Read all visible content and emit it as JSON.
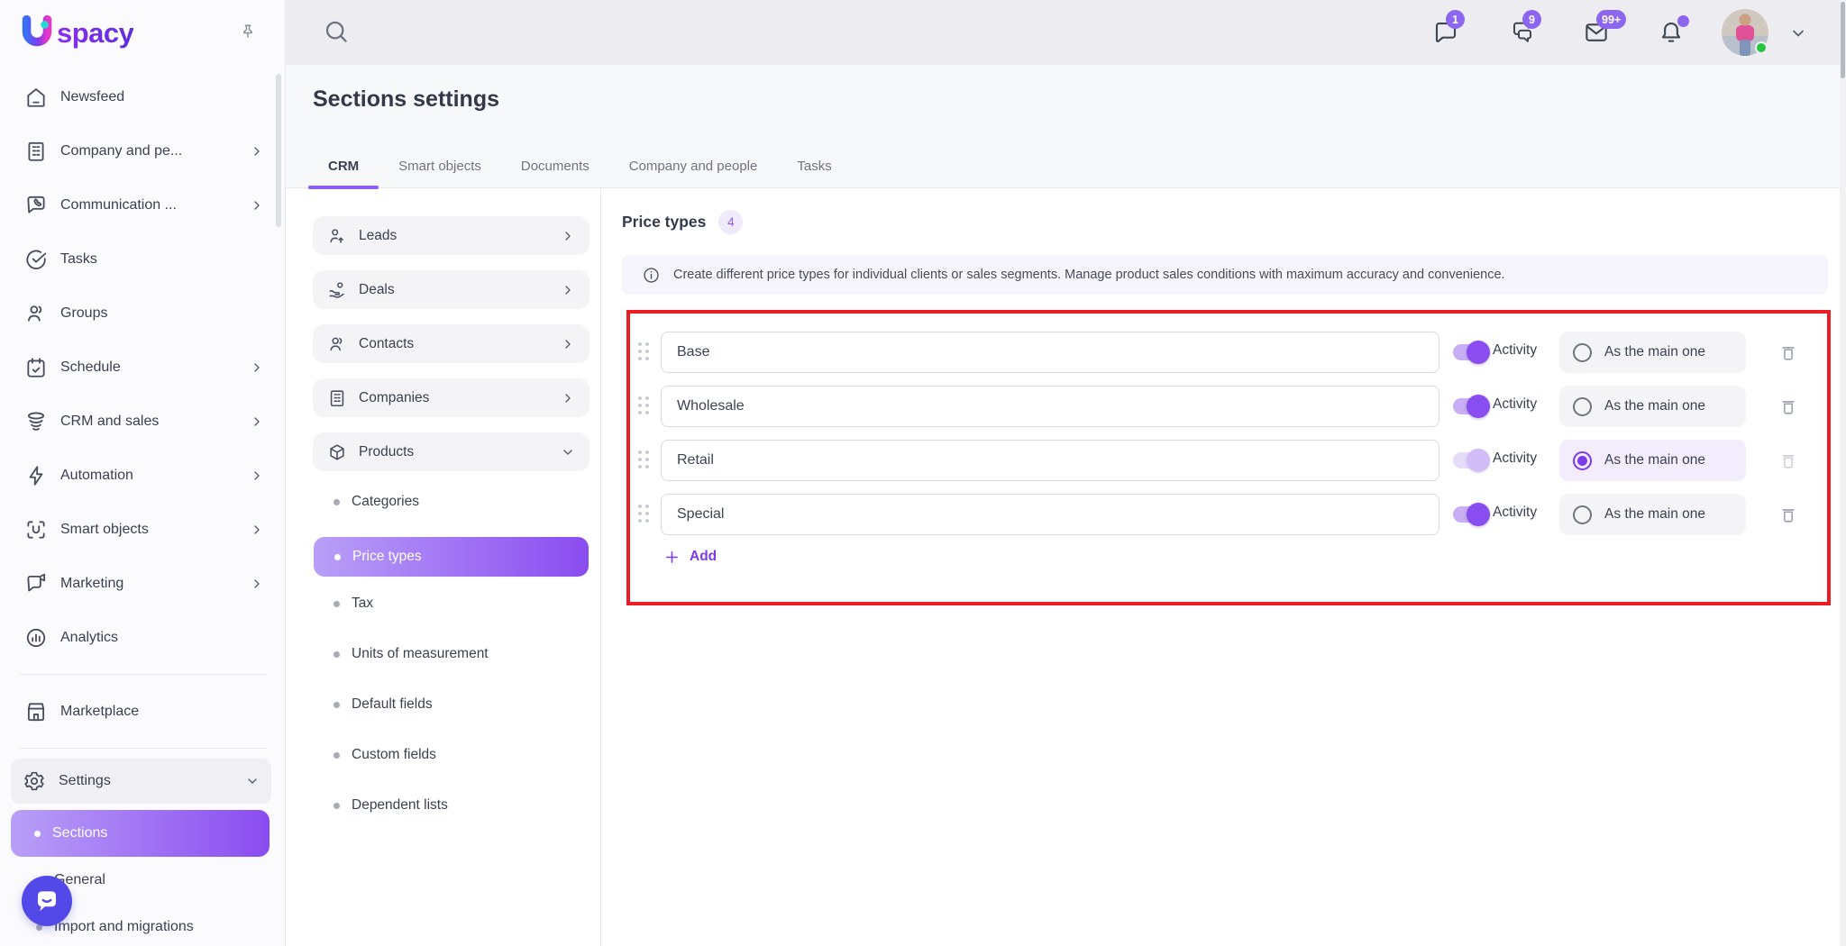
{
  "brand": {
    "name": "Uspacy",
    "wordmark": "spacy"
  },
  "topbar": {
    "badges": {
      "messenger": "1",
      "group_chats": "9",
      "mail": "99+"
    },
    "icons": [
      "search-icon",
      "messenger-icon",
      "group-chats-icon",
      "mail-icon",
      "bell-icon",
      "avatar",
      "chevron-down-icon"
    ]
  },
  "sidebar": {
    "items": [
      {
        "label": "Newsfeed",
        "icon": "home-icon",
        "chevron": null
      },
      {
        "label": "Company and pe...",
        "icon": "building-icon",
        "chevron": "right"
      },
      {
        "label": "Communication ...",
        "icon": "chat-phone-icon",
        "chevron": "right"
      },
      {
        "label": "Tasks",
        "icon": "check-circle-icon",
        "chevron": null
      },
      {
        "label": "Groups",
        "icon": "users-icon",
        "chevron": null
      },
      {
        "label": "Schedule",
        "icon": "calendar-check-icon",
        "chevron": "right"
      },
      {
        "label": "CRM and sales",
        "icon": "funnel-layers-icon",
        "chevron": "right"
      },
      {
        "label": "Automation",
        "icon": "lightning-icon",
        "chevron": "right"
      },
      {
        "label": "Smart objects",
        "icon": "scan-object-icon",
        "chevron": "right"
      },
      {
        "label": "Marketing",
        "icon": "megaphone-bubble-icon",
        "chevron": "right"
      },
      {
        "label": "Analytics",
        "icon": "chart-circle-icon",
        "chevron": null
      },
      {
        "label": "Marketplace",
        "icon": "storefront-icon",
        "chevron": null
      }
    ],
    "settings_label": "Settings",
    "sections_label": "Sections",
    "sub_items": [
      "General",
      "Import and migrations"
    ]
  },
  "header": {
    "title": "Sections settings",
    "tabs": [
      "CRM",
      "Smart objects",
      "Documents",
      "Company and people",
      "Tasks"
    ],
    "active_tab": "CRM"
  },
  "crm_sections": {
    "cards": [
      {
        "label": "Leads",
        "icon": "lead-person-icon",
        "chevron": "right"
      },
      {
        "label": "Deals",
        "icon": "deal-hand-icon",
        "chevron": "right"
      },
      {
        "label": "Contacts",
        "icon": "contacts-icon",
        "chevron": "right"
      },
      {
        "label": "Companies",
        "icon": "companies-icon",
        "chevron": "right"
      },
      {
        "label": "Products",
        "icon": "product-box-icon",
        "chevron": "down"
      }
    ],
    "sub_items": [
      "Categories",
      "Price types",
      "Tax",
      "Units of measurement",
      "Default fields",
      "Custom fields",
      "Dependent lists"
    ],
    "active_sub_item": "Price types"
  },
  "main": {
    "section_title": "Price types",
    "count": "4",
    "info": "Create different price types for individual clients or sales segments. Manage product sales conditions with maximum accuracy and convenience.",
    "activity_label": "Activity",
    "main_label": "As the main one",
    "add_label": "Add",
    "rows": [
      {
        "name": "Base",
        "activity": true,
        "main": false
      },
      {
        "name": "Wholesale",
        "activity": true,
        "main": false
      },
      {
        "name": "Retail",
        "activity": true,
        "main": true
      },
      {
        "name": "Special",
        "activity": true,
        "main": false
      }
    ]
  },
  "colors": {
    "accent_purple": "#8b5cf6",
    "pill_gradient": [
      "#b99ff8",
      "#8a4cf0"
    ],
    "highlight_annotation_red": "#ec1c24",
    "badge_purple": "#8d66f0",
    "online_green": "#27c440"
  }
}
